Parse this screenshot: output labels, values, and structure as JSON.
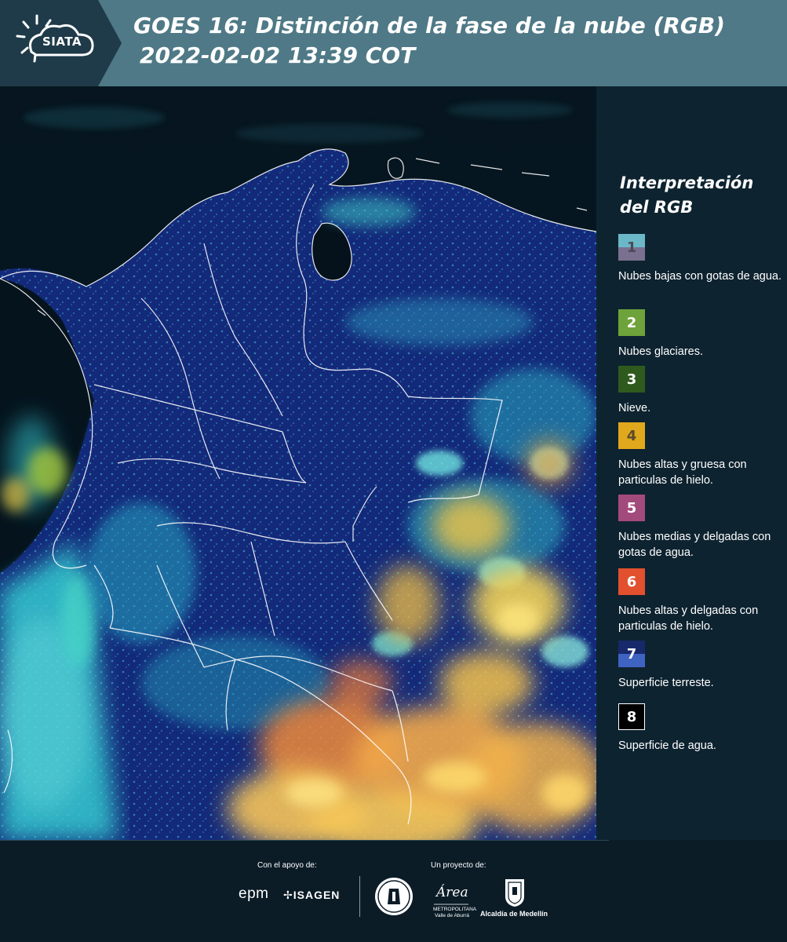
{
  "header": {
    "logo_text": "SIATA",
    "title_line1": "GOES 16: Distinción de la fase de la nube (RGB)",
    "title_line2": "2022-02-02 13:39 COT"
  },
  "legend": {
    "title": "Interpretación del RGB",
    "items": [
      {
        "number": "1",
        "label": "Nubes bajas con gotas de agua.",
        "color_top": "#6bb8c8",
        "color_bottom": "#7a708f",
        "number_color": "#4a4a55"
      },
      {
        "number": "2",
        "label": "Nubes glaciares.",
        "color": "#6ea23a",
        "number_color": "#ffffff"
      },
      {
        "number": "3",
        "label": "Nieve.",
        "color": "#2f5a1e",
        "number_color": "#ffffff"
      },
      {
        "number": "4",
        "label": "Nubes altas y gruesa con particulas de hielo.",
        "color": "#e0a81c",
        "number_color": "#5a4a2a"
      },
      {
        "number": "5",
        "label": "Nubes medias y delgadas con gotas de agua.",
        "color": "#a34a7c",
        "number_color": "#ffffff"
      },
      {
        "number": "6",
        "label": "Nubes altas y delgadas con particulas de hielo.",
        "color": "#e2502e",
        "number_color": "#ffffff"
      },
      {
        "number": "7",
        "label": "Superficie terreste.",
        "color_top": "#18296b",
        "color_bottom": "#3f63c0",
        "number_color": "#ffffff"
      },
      {
        "number": "8",
        "label": "Superficie de agua.",
        "color": "#000000",
        "number_color": "#ffffff",
        "border": "#ffffff"
      }
    ]
  },
  "footer": {
    "support_label": "Con el apoyo de:",
    "project_label": "Un proyecto de:",
    "sponsors": [
      "epm",
      "ISAGEN"
    ],
    "area_script": "Área",
    "area_sub": "METROPOLITANA Valle de Aburrá",
    "medellin_label": "Alcaldía de Medellín"
  },
  "map": {
    "colors": {
      "ocean": "#04101a",
      "land": "#16318a",
      "cloud_cyan": "#3fd6d0",
      "cloud_yellow": "#f2c84a",
      "cloud_orange": "#ef8a3a",
      "border_line": "#ffffff"
    }
  }
}
